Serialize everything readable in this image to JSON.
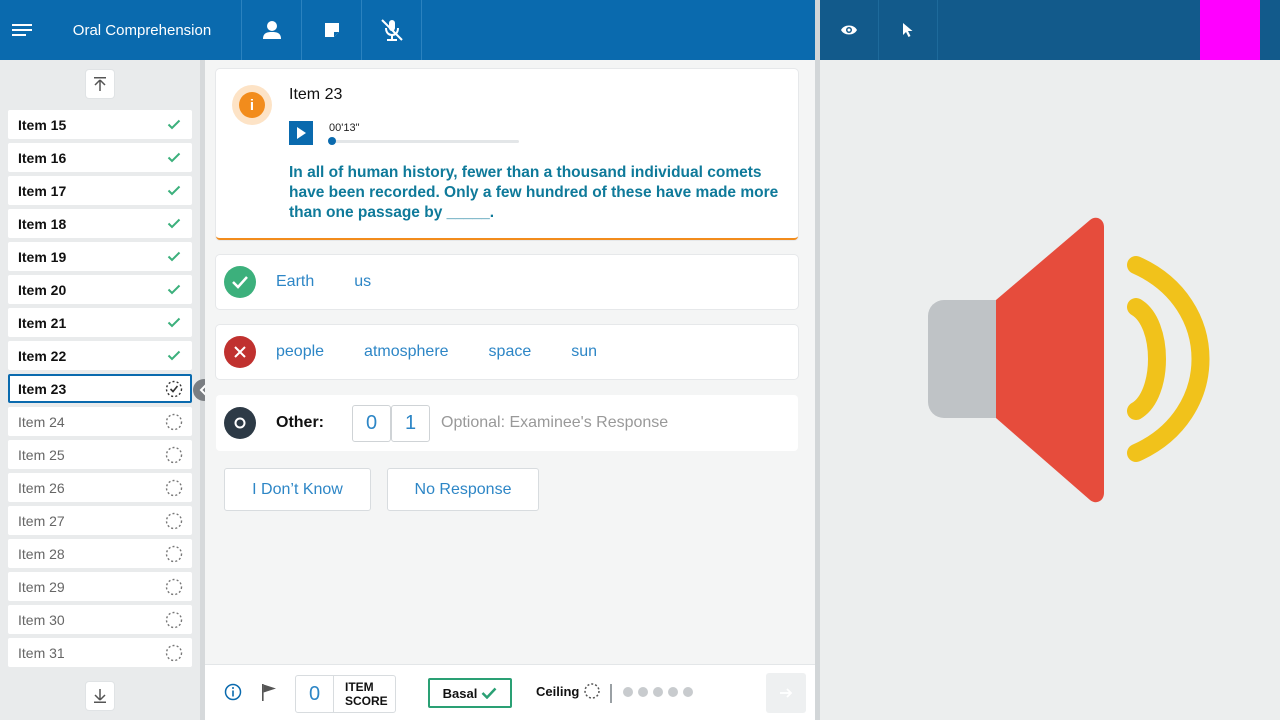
{
  "app": {
    "title": "Oral Comprehension"
  },
  "topbar": {
    "icons": [
      "menu-icon",
      "person-icon",
      "note-icon",
      "mic-off-icon"
    ],
    "right_icons": [
      "eye-icon",
      "cursor-icon"
    ],
    "accent": "#0a6aae"
  },
  "sidebar": {
    "items": [
      {
        "label": "Item 15",
        "status": "complete"
      },
      {
        "label": "Item 16",
        "status": "complete"
      },
      {
        "label": "Item 17",
        "status": "complete"
      },
      {
        "label": "Item 18",
        "status": "complete"
      },
      {
        "label": "Item 19",
        "status": "complete"
      },
      {
        "label": "Item 20",
        "status": "complete"
      },
      {
        "label": "Item 21",
        "status": "complete"
      },
      {
        "label": "Item 22",
        "status": "complete"
      },
      {
        "label": "Item 23",
        "status": "current"
      },
      {
        "label": "Item 24",
        "status": "pending"
      },
      {
        "label": "Item 25",
        "status": "pending"
      },
      {
        "label": "Item 26",
        "status": "pending"
      },
      {
        "label": "Item 27",
        "status": "pending"
      },
      {
        "label": "Item 28",
        "status": "pending"
      },
      {
        "label": "Item 29",
        "status": "pending"
      },
      {
        "label": "Item 30",
        "status": "pending"
      },
      {
        "label": "Item 31",
        "status": "pending"
      }
    ]
  },
  "question": {
    "title": "Item 23",
    "audio_time": "00'13\"",
    "text": "In all of human history, fewer than a thousand individual comets have been recorded. Only a few hundred of these have made more than one passage by _____."
  },
  "answers": {
    "correct": [
      "Earth",
      "us"
    ],
    "incorrect": [
      "people",
      "atmosphere",
      "space",
      "sun"
    ],
    "other": {
      "label": "Other:",
      "scores": [
        "0",
        "1"
      ],
      "placeholder": "Optional: Examinee's Response"
    }
  },
  "options": {
    "dont_know": "I Don’t Know",
    "no_response": "No Response"
  },
  "bottom": {
    "item_score_value": "0",
    "item_score_label_1": "ITEM",
    "item_score_label_2": "SCORE",
    "basal": "Basal",
    "ceiling": "Ceiling"
  },
  "colors": {
    "correct": "#3cb07c",
    "incorrect": "#c0312f",
    "other": "#2d3a46",
    "info": "#f28c1c",
    "speaker_red": "#e64c3c",
    "speaker_yellow": "#f1c21b",
    "speaker_grey": "#bfc3c6",
    "magenta": "#ff00ff"
  }
}
